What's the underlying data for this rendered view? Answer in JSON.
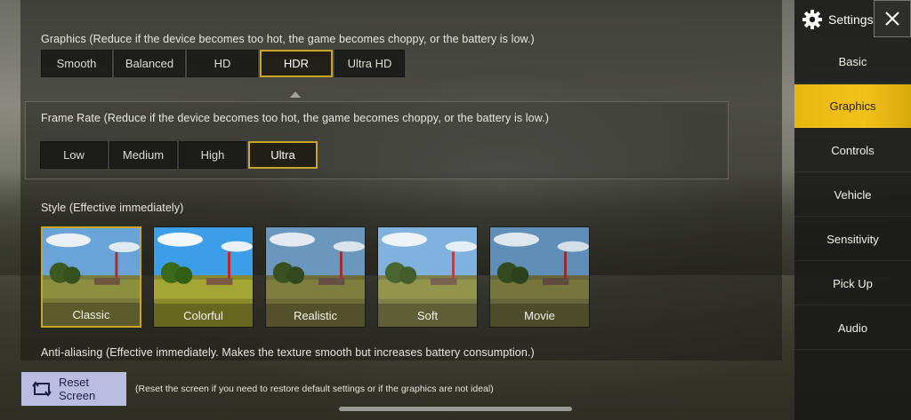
{
  "graphics": {
    "label": "Graphics (Reduce if the device becomes too hot, the game becomes choppy, or the battery is low.)",
    "options": [
      "Smooth",
      "Balanced",
      "HD",
      "HDR",
      "Ultra HD"
    ],
    "selected": "HDR"
  },
  "frame_rate": {
    "label": "Frame Rate (Reduce if the device becomes too hot, the game becomes choppy, or the battery is low.)",
    "options": [
      "Low",
      "Medium",
      "High",
      "Ultra"
    ],
    "selected": "Ultra"
  },
  "style": {
    "label": "Style (Effective immediately)",
    "options": [
      "Classic",
      "Colorful",
      "Realistic",
      "Soft",
      "Movie"
    ],
    "selected": "Classic"
  },
  "anti_aliasing": {
    "label": "Anti-aliasing (Effective immediately. Makes the texture smooth but increases battery consumption.)"
  },
  "reset": {
    "button_label": "Reset Screen",
    "note": "(Reset the screen if you need to restore default settings or if the graphics are not ideal)"
  },
  "sidebar": {
    "title": "Settings",
    "items": [
      "Basic",
      "Graphics",
      "Controls",
      "Vehicle",
      "Sensitivity",
      "Pick Up",
      "Audio"
    ],
    "active": "Graphics"
  },
  "colors": {
    "accent_gold": "#e9b610",
    "selected_border": "#c9a528",
    "reset_button": "#b9bde0"
  },
  "icons": {
    "settings": "gear-icon",
    "close": "close-icon",
    "reset": "reset-screen-icon"
  }
}
